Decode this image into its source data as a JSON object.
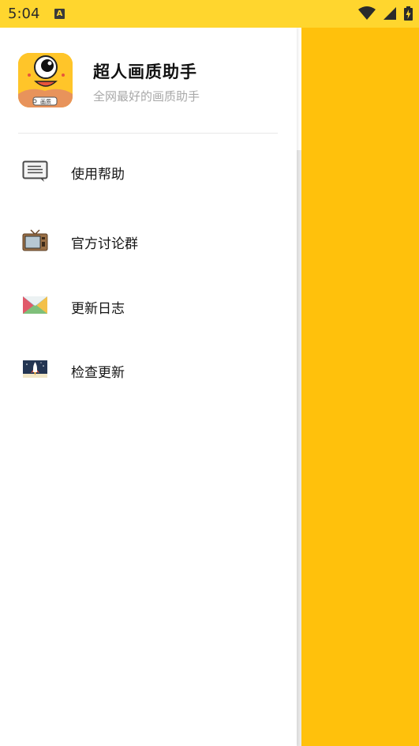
{
  "status_bar": {
    "time": "5:04",
    "notification_icon_letter": "A",
    "icons": [
      "wifi-icon",
      "cell-signal-icon",
      "battery-charging-icon"
    ],
    "background": "#FFD62E"
  },
  "drawer": {
    "app_title": "超人画质助手",
    "app_subtitle": "全网最好的画质助手",
    "app_icon_badge": "画质",
    "menu": [
      {
        "label": "使用帮助",
        "icon": "message-icon"
      },
      {
        "label": "官方讨论群",
        "icon": "tv-icon"
      },
      {
        "label": "更新日志",
        "icon": "envelope-icon"
      },
      {
        "label": "检查更新",
        "icon": "rocket-icon"
      }
    ]
  },
  "main": {
    "background": "#FFC10C"
  }
}
